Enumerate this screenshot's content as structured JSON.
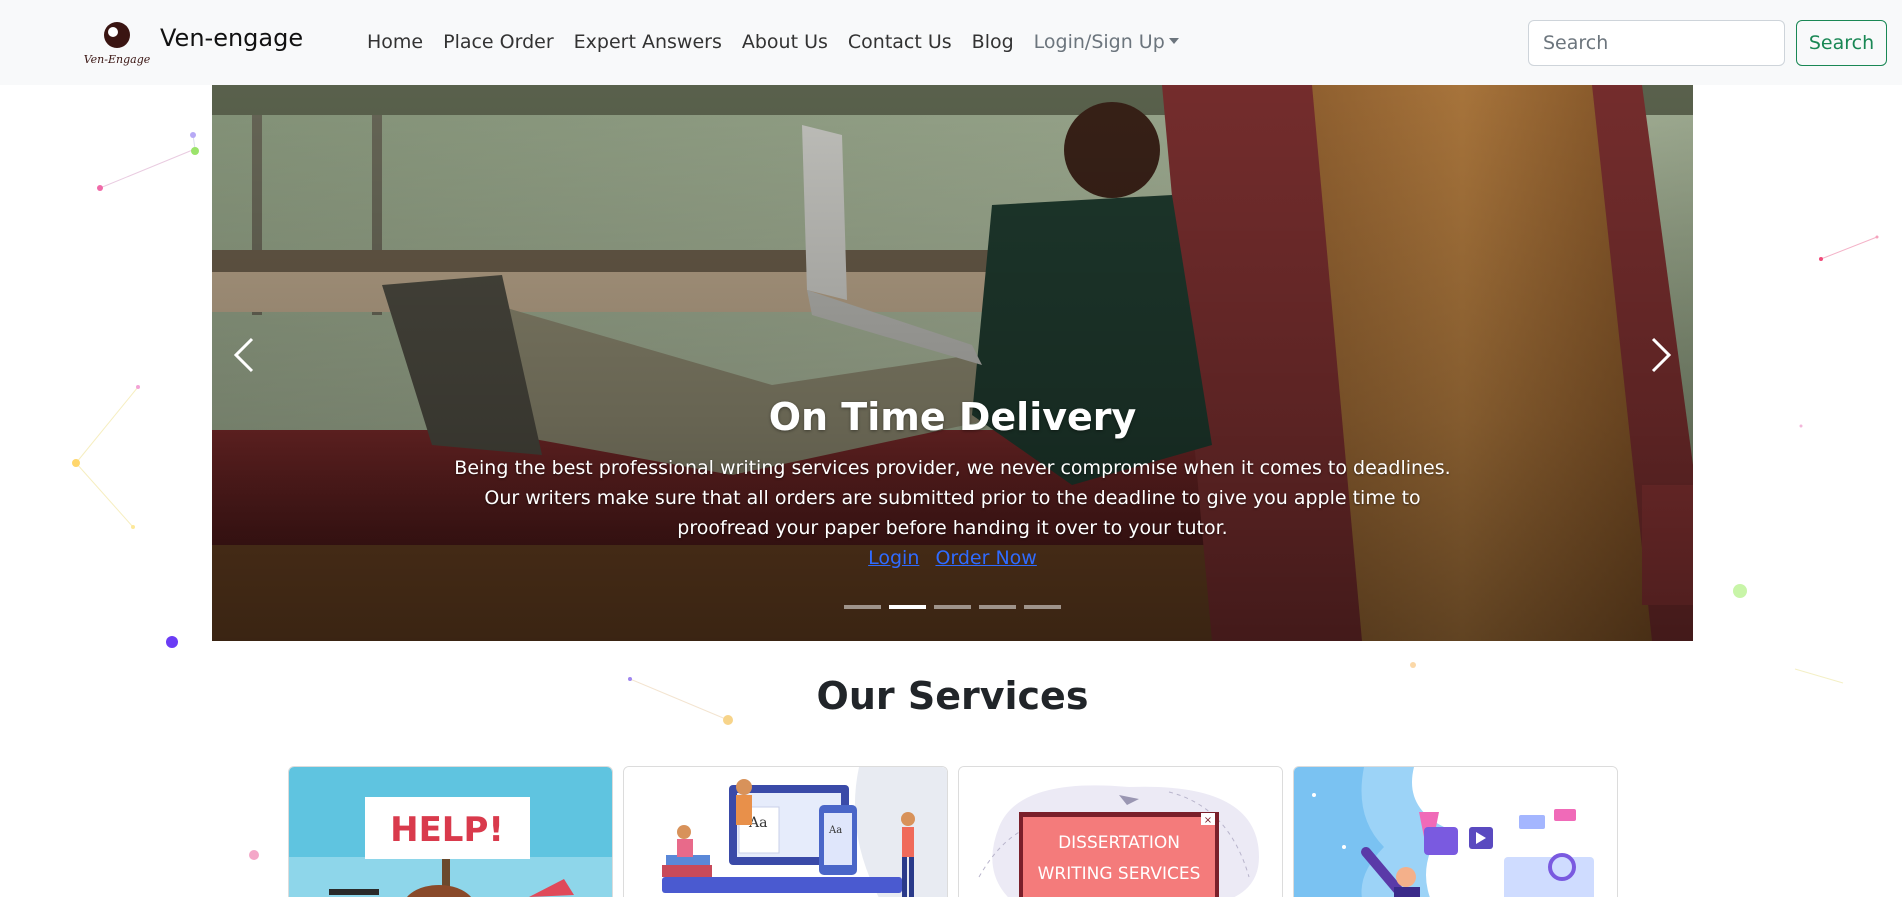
{
  "navbar": {
    "brand_name": "Ven-engage",
    "logo_text": "Ven-Engage",
    "links": [
      "Home",
      "Place Order",
      "Expert Answers",
      "About Us",
      "Contact Us",
      "Blog"
    ],
    "dropdown_label": "Login/Sign Up",
    "search_placeholder": "Search",
    "search_button": "Search"
  },
  "carousel": {
    "title": "On Time Delivery",
    "text": "Being the best professional writing services provider, we never compromise when it comes to deadlines. Our writers make sure that all orders are submitted prior to the deadline to give you apple time to proofread your paper before handing it over to your tutor.",
    "login_link": "Login",
    "order_link": "Order Now",
    "slide_count": 5,
    "active_slide": 2
  },
  "services": {
    "title": "Our Services",
    "cards": [
      {
        "image": "help-illustration",
        "image_text": "HELP!"
      },
      {
        "image": "online-learning-illustration"
      },
      {
        "image": "dissertation-illustration",
        "image_text_line1": "DISSERTATION",
        "image_text_line2": "WRITING SERVICES"
      },
      {
        "image": "digital-writing-illustration"
      }
    ]
  },
  "colors": {
    "accent_green": "#198754",
    "link_blue": "#2f6bff",
    "navbar_bg": "#f8f9fa"
  }
}
